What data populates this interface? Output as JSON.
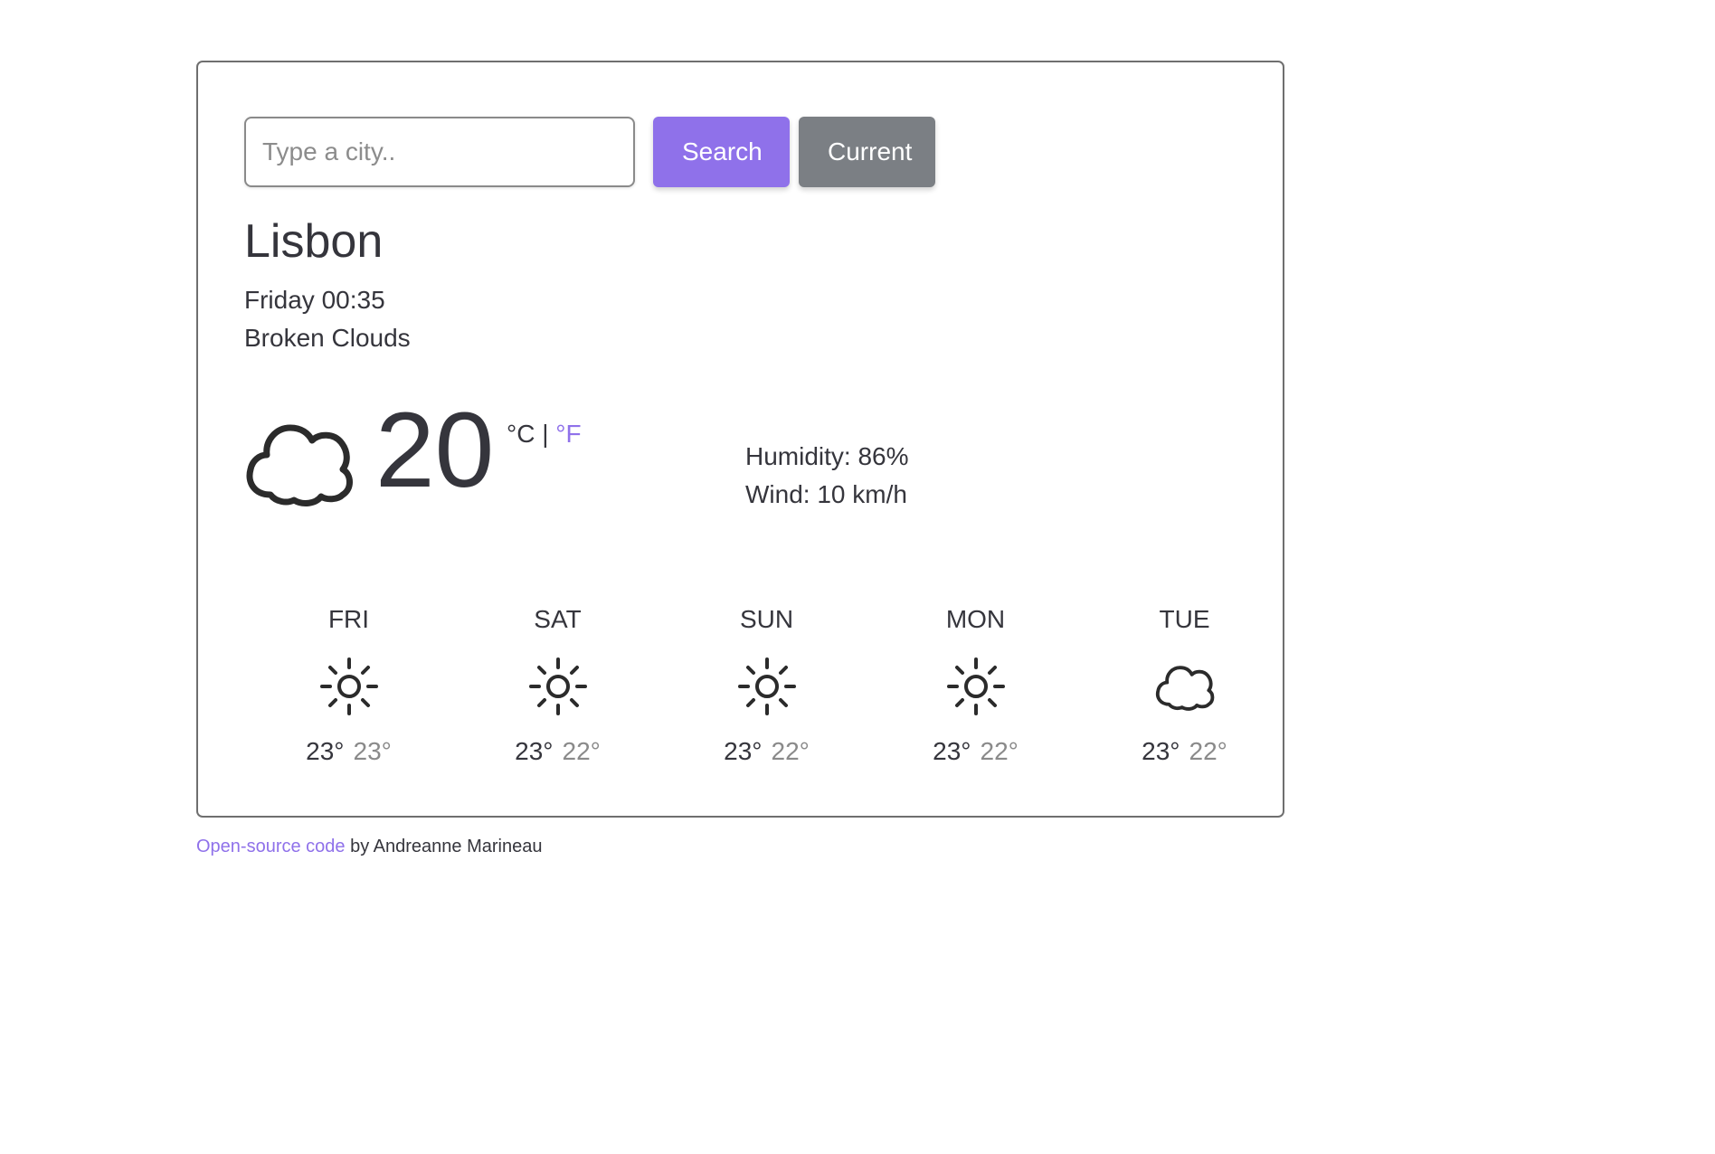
{
  "search": {
    "placeholder": "Type a city..",
    "search_label": "Search",
    "current_label": "Current"
  },
  "current": {
    "city": "Lisbon",
    "datetime": "Friday 00:35",
    "description": "Broken Clouds",
    "icon": "cloud-icon",
    "temperature": "20",
    "unit_c": "°C",
    "unit_separator": "|",
    "unit_f": "°F",
    "humidity": "Humidity: 86%",
    "wind": "Wind: 10 km/h"
  },
  "forecast": [
    {
      "day": "FRI",
      "icon": "sun-icon",
      "max": "23°",
      "min": "23°"
    },
    {
      "day": "SAT",
      "icon": "sun-icon",
      "max": "23°",
      "min": "22°"
    },
    {
      "day": "SUN",
      "icon": "sun-icon",
      "max": "23°",
      "min": "22°"
    },
    {
      "day": "MON",
      "icon": "sun-icon",
      "max": "23°",
      "min": "22°"
    },
    {
      "day": "TUE",
      "icon": "cloud-icon",
      "max": "23°",
      "min": "22°"
    }
  ],
  "footer": {
    "link_text": "Open-source code",
    "suffix": " by Andreanne Marineau"
  },
  "colors": {
    "accent": "#8f71ea",
    "secondary_button": "#7b7f84",
    "text": "#35353c",
    "muted": "#8a8a8a"
  }
}
